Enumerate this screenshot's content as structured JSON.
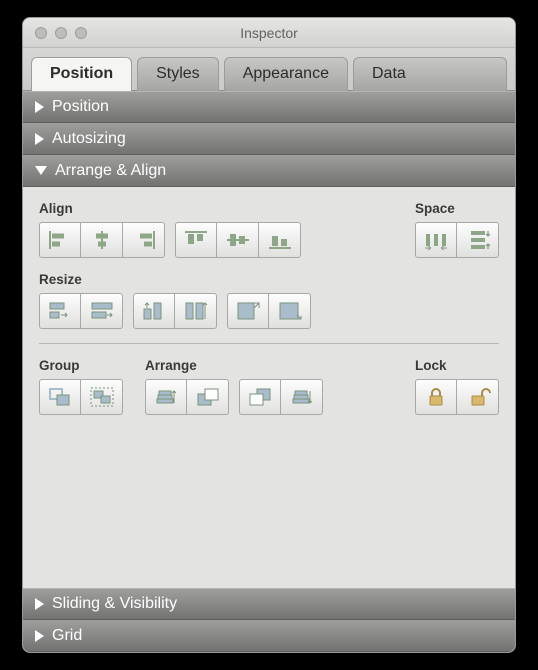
{
  "window": {
    "title": "Inspector"
  },
  "tabs": {
    "position": "Position",
    "styles": "Styles",
    "appearance": "Appearance",
    "data": "Data",
    "active": "position"
  },
  "sections": {
    "position": {
      "label": "Position",
      "expanded": false
    },
    "autosizing": {
      "label": "Autosizing",
      "expanded": false
    },
    "arrange_align": {
      "label": "Arrange & Align",
      "expanded": true
    },
    "sliding": {
      "label": "Sliding & Visibility",
      "expanded": false
    },
    "grid": {
      "label": "Grid",
      "expanded": false
    }
  },
  "arrange_align": {
    "align_label": "Align",
    "space_label": "Space",
    "resize_label": "Resize",
    "group_label": "Group",
    "arrange_label": "Arrange",
    "lock_label": "Lock"
  }
}
